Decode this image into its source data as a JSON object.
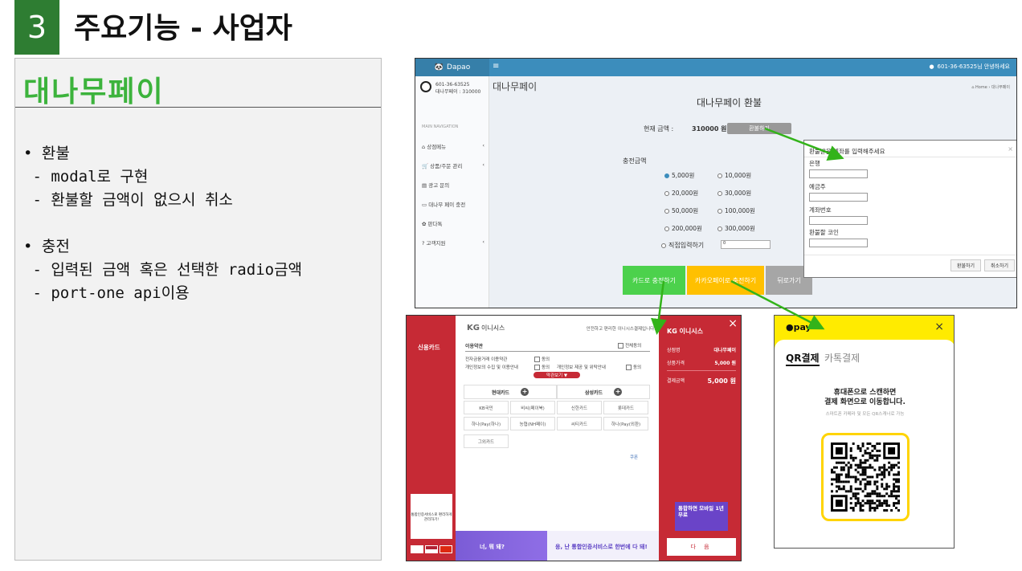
{
  "slide": {
    "number": "3",
    "title": "주요기능 - 사업자"
  },
  "left_panel": {
    "title": "대나무페이",
    "bullets": [
      "• 환불",
      " - modal로 구현",
      " - 환불할 금액이 없으시 취소",
      "• 충전",
      " - 입력된 금액 혹은 선택한 radio금액",
      " - port-one api이용"
    ]
  },
  "admin": {
    "brand": "Dapao",
    "menu_icon": "≡",
    "top_user": "601-36-63525님 안녕하세요",
    "user_line1": "601-36-63525",
    "user_line2": "대나무페이 : 310000",
    "nav_label": "MAIN NAVIGATION",
    "nav": [
      {
        "icon": "⌂",
        "label": "상점메뉴",
        "caret": "‹"
      },
      {
        "icon": "🛒",
        "label": "상품/주문 관리",
        "caret": "‹"
      },
      {
        "icon": "▤",
        "label": "광고 문의",
        "caret": ""
      },
      {
        "icon": "▭",
        "label": "대나무 페이 충전",
        "caret": ""
      },
      {
        "icon": "✿",
        "label": "판다톡",
        "caret": ""
      },
      {
        "icon": "?",
        "label": "고객지원",
        "caret": "‹"
      }
    ],
    "page_title": "대나무페이",
    "breadcrumb": "⌂ Home › 대나무페이",
    "card_title": "대나무페이 환불",
    "current_label": "현재 금액 :",
    "current_amount": "310000 원",
    "refund_button": "환불하기",
    "charge_label": "충전금액",
    "options": [
      {
        "label": "5,000원",
        "checked": true
      },
      {
        "label": "10,000원",
        "checked": false
      },
      {
        "label": "20,000원",
        "checked": false
      },
      {
        "label": "30,000원",
        "checked": false
      },
      {
        "label": "50,000원",
        "checked": false
      },
      {
        "label": "100,000원",
        "checked": false
      },
      {
        "label": "200,000원",
        "checked": false
      },
      {
        "label": "300,000원",
        "checked": false
      }
    ],
    "direct_label": "직접입력하기",
    "direct_value": "0",
    "card_pay_button": "카드로 충전하기",
    "kakao_pay_button": "카카오페이로 충전하기",
    "back_button": "뒤로가기",
    "colors": {
      "topbar": "#3c8dbc",
      "card_btn": "#4cd14c",
      "kakao_btn": "#ffc000",
      "back_btn": "#a6a6a6"
    }
  },
  "modal": {
    "title": "환불받을 계좌를 입력해주세요",
    "close": "×",
    "fields": [
      "은행",
      "예금주",
      "계좌번호",
      "환불할 코인"
    ],
    "confirm": "환불하기",
    "cancel": "취소하기"
  },
  "inicis": {
    "left_title": "신용카드",
    "logo": "KG",
    "logo_sub": "이니시스",
    "note": "안전하고 편리한 이니시스결제입니다.",
    "terms_title": "이용약관",
    "agree_all": "전체동의",
    "term1": "전자금융거래 이용약관",
    "term2": "개인정보의 수집 및 이용안내",
    "term3": "개인정보 제공 및 위탁안내",
    "agree": "동의",
    "terms_btn": "약관보기 ▼",
    "card_hdr1": "현대카드",
    "card_hdr2": "삼성카드",
    "cards": [
      "KB국민",
      "비씨(페이북)",
      "신한카드",
      "롯데카드",
      "하나(Pay(하나)",
      "농협(NH페이)",
      "씨티카드",
      "하나(Pay(외환)",
      "그외카드"
    ],
    "coupon": "쿠폰",
    "ad_left": "너, 뭐 돼?",
    "ad_right": "응, 난 통합인증서비스로 한번에 다 돼!",
    "left_ad": "통합인증서비스로 편리하게 관리하기!",
    "right_logo": "KG 이니시스",
    "rows": [
      {
        "k": "상점명",
        "v": "대나무페이"
      },
      {
        "k": "상품가격",
        "v": "5,000 원"
      },
      {
        "k": "결제금액",
        "v": "5,000 원"
      }
    ],
    "promo": "통합하면 모바일 1년 무료",
    "next": "다 음"
  },
  "kakao": {
    "logo": "●pay",
    "close": "×",
    "tab_qr": "QR결제",
    "tab_talk": "카톡결제",
    "msg_line1": "휴대폰으로 스캔하면",
    "msg_line2": "결제 화면으로 이동합니다.",
    "sub": "스마트폰 카메라 및 모든 QR스캐너로 가능"
  }
}
